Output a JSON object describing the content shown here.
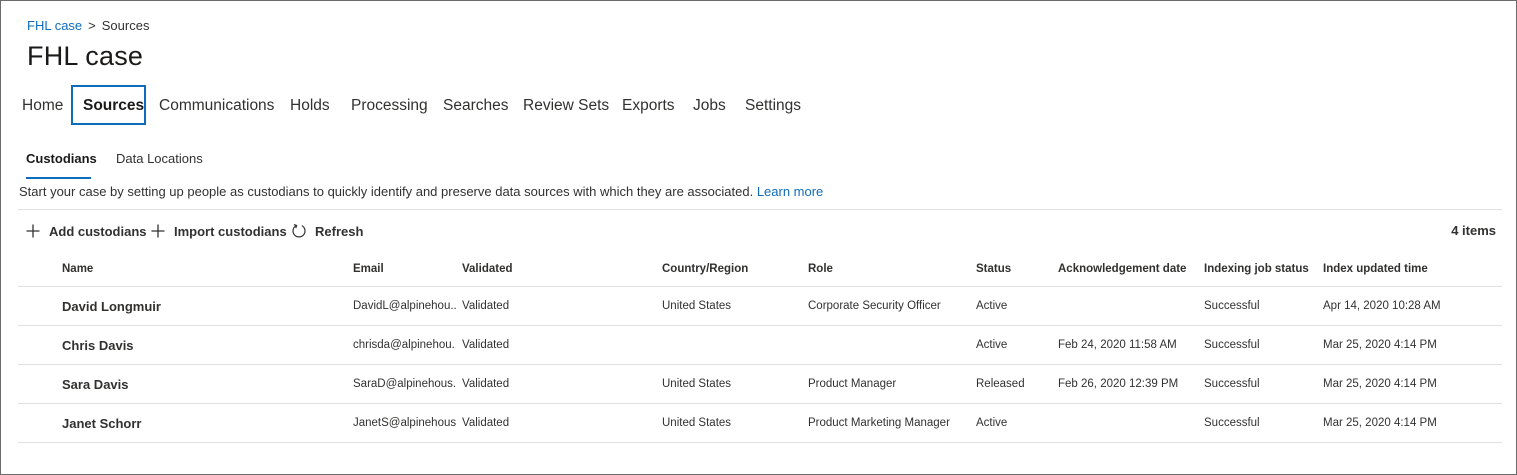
{
  "breadcrumb": {
    "parent": "FHL case",
    "separator": ">",
    "current": "Sources"
  },
  "page": {
    "title": "FHL case"
  },
  "main_tabs": [
    {
      "label": "Home"
    },
    {
      "label": "Sources"
    },
    {
      "label": "Communications"
    },
    {
      "label": "Holds"
    },
    {
      "label": "Processing"
    },
    {
      "label": "Searches"
    },
    {
      "label": "Review Sets"
    },
    {
      "label": "Exports"
    },
    {
      "label": "Jobs"
    },
    {
      "label": "Settings"
    }
  ],
  "active_main_tab": "Sources",
  "sub_tabs": [
    {
      "label": "Custodians"
    },
    {
      "label": "Data Locations"
    }
  ],
  "active_sub_tab": "Custodians",
  "intro": {
    "text": "Start your case by setting up people as custodians to quickly identify and preserve data sources with which they are associated.",
    "link": "Learn more"
  },
  "toolbar": {
    "add_label": "Add custodians",
    "add_icon": "plus-icon",
    "import_label": "Import custodians",
    "import_icon": "plus-icon",
    "refresh_label": "Refresh",
    "refresh_icon": "refresh-icon",
    "item_count": "4 items"
  },
  "table": {
    "columns": {
      "name": "Name",
      "email": "Email",
      "validated": "Validated",
      "country": "Country/Region",
      "role": "Role",
      "status": "Status",
      "ack": "Acknowledgement date",
      "indexing": "Indexing job status",
      "index_time": "Index updated time"
    },
    "rows": [
      {
        "name": "David Longmuir",
        "email": "DavidL@alpinehou...",
        "validated": "Validated",
        "country": "United States",
        "role": "Corporate Security Officer",
        "status": "Active",
        "ack": "",
        "indexing": "Successful",
        "index_time": "Apr 14, 2020 10:28 AM"
      },
      {
        "name": "Chris Davis",
        "email": "chrisda@alpinehou...",
        "validated": "Validated",
        "country": "",
        "role": "",
        "status": "Active",
        "ack": "Feb 24, 2020 11:58 AM",
        "indexing": "Successful",
        "index_time": "Mar 25, 2020 4:14 PM"
      },
      {
        "name": "Sara Davis",
        "email": "SaraD@alpinehous...",
        "validated": "Validated",
        "country": "United States",
        "role": "Product Manager",
        "status": "Released",
        "ack": "Feb 26, 2020 12:39 PM",
        "indexing": "Successful",
        "index_time": "Mar 25, 2020 4:14 PM"
      },
      {
        "name": "Janet Schorr",
        "email": "JanetS@alpinehous...",
        "validated": "Validated",
        "country": "United States",
        "role": "Product Marketing Manager",
        "status": "Active",
        "ack": "",
        "indexing": "Successful",
        "index_time": "Mar 25, 2020 4:14 PM"
      }
    ]
  },
  "colors": {
    "accent": "#0f6cbd",
    "text": "#323130",
    "divider": "#e1dfdd",
    "frame": "#6b6b6b"
  }
}
